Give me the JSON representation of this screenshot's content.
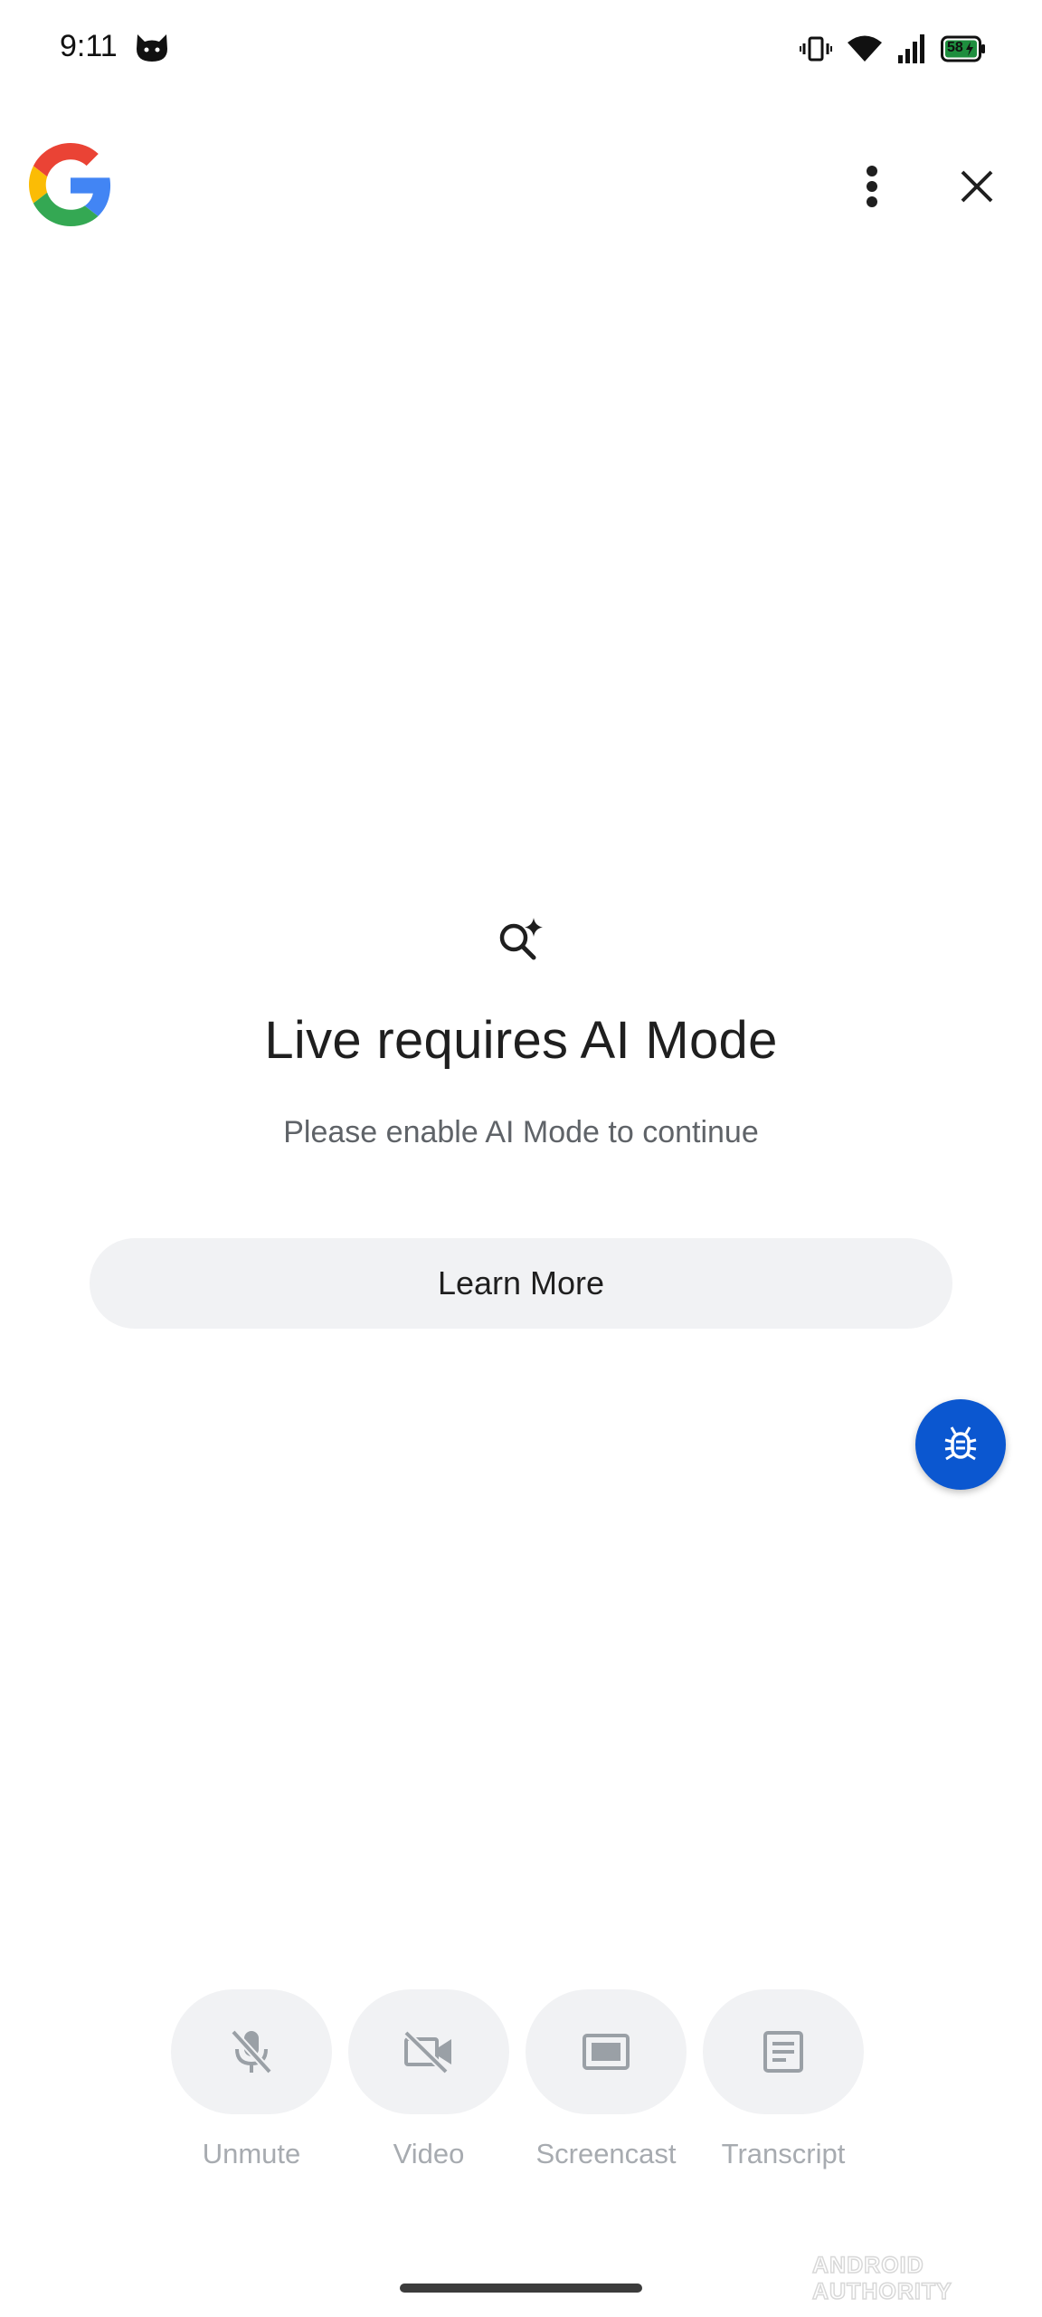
{
  "status_bar": {
    "time": "9:11",
    "battery_level": "58",
    "battery_color": "#1e8e3e",
    "icons": [
      "cat-icon",
      "vibrate-icon",
      "wifi-icon",
      "signal-icon",
      "battery-charging-icon"
    ]
  },
  "header": {
    "logo": "google-g-logo",
    "icons": [
      "more-vert-icon",
      "close-icon"
    ]
  },
  "main": {
    "icon": "search-sparkle-icon",
    "title": "Live requires AI Mode",
    "subtitle": "Please enable AI Mode to continue",
    "learn_more_label": "Learn More"
  },
  "fab": {
    "icon": "bug-icon",
    "color": "#0b57d0"
  },
  "controls": [
    {
      "label": "Unmute",
      "icon": "mic-off-icon"
    },
    {
      "label": "Video",
      "icon": "videocam-off-icon"
    },
    {
      "label": "Screencast",
      "icon": "screencast-icon"
    },
    {
      "label": "Transcript",
      "icon": "transcript-icon"
    }
  ],
  "watermark": "ANDROID AUTHORITY",
  "colors": {
    "button_bg": "#f1f2f4",
    "disabled_label": "#a7abb0",
    "google_blue": "#4285F4",
    "google_red": "#EA4335",
    "google_yellow": "#FBBC05",
    "google_green": "#34A853"
  }
}
